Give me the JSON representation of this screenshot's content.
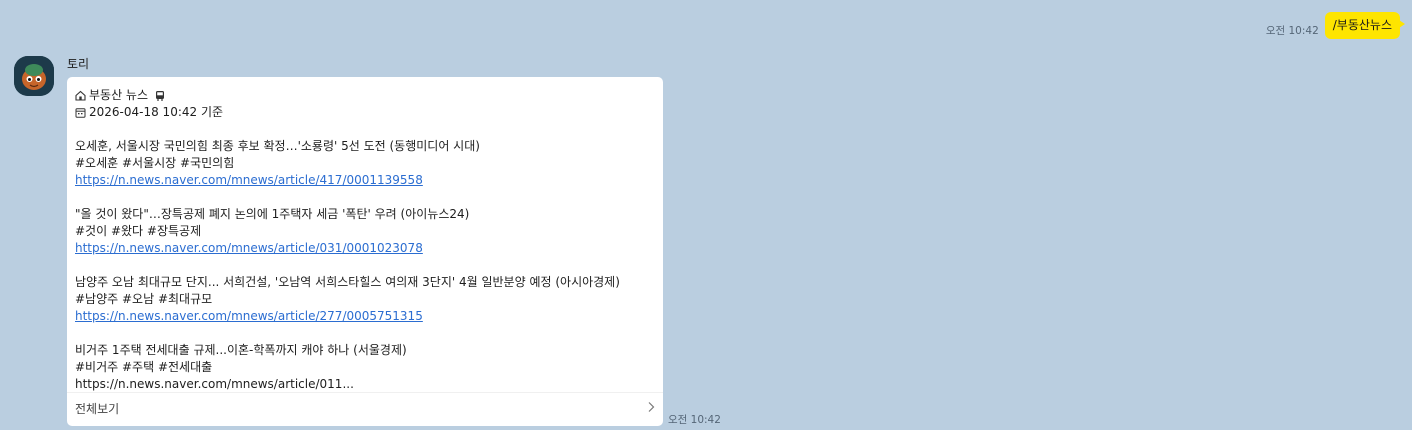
{
  "outgoing": {
    "time": "오전 10:42",
    "text": "/부동산뉴스"
  },
  "incoming": {
    "sender": "토리",
    "time": "오전 10:42",
    "header_title": "부동산 뉴스",
    "header_date": "2026-04-18 10:42 기준",
    "articles": [
      {
        "title": "오세훈, 서울시장 국민의힘 최종 후보 확정…'소룡령' 5선 도전 (동행미디어 시대)",
        "tags": "#오세훈 #서울시장 #국민의힘",
        "url": "https://n.news.naver.com/mnews/article/417/0001139558"
      },
      {
        "title": "\"올 것이 왔다\"…장특공제 폐지 논의에 1주택자 세금 '폭탄' 우려 (아이뉴스24)",
        "tags": "#것이 #왔다 #장특공제",
        "url": "https://n.news.naver.com/mnews/article/031/0001023078"
      },
      {
        "title": "남양주 오남 최대규모 단지... 서희건설, '오남역 서희스타힐스 여의재 3단지' 4월 일반분양 예정 (아시아경제)",
        "tags": "#남양주 #오남 #최대규모",
        "url": "https://n.news.naver.com/mnews/article/277/0005751315"
      },
      {
        "title": "비거주 1주택 전세대출 규제...이혼-학폭까지 캐야 하나 (서울경제)",
        "tags": "#비거주 #주택 #전세대출",
        "url": "https://n.news.naver.com/mnews/article/011..."
      }
    ],
    "footer_label": "전체보기"
  },
  "colors": {
    "background": "#bacee0",
    "outgoing_bubble": "#fee500",
    "incoming_bubble": "#ffffff",
    "link": "#2b6dd1"
  },
  "icons": {
    "header_title_icon": "house-icon",
    "header_title_trailing_icon": "bus-icon",
    "header_date_icon": "calendar-icon",
    "footer_icon": "chevron-right-icon"
  }
}
